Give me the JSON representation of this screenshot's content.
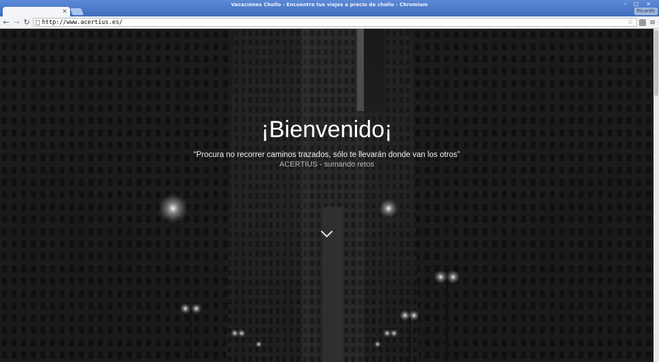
{
  "window": {
    "title": "Vacaciones Chollo - Encuentra tus viajes a precio de chollo - Chromium",
    "profile": "Ricardo",
    "controls": "– □ ×"
  },
  "tab": {
    "close": "×"
  },
  "toolbar": {
    "back": "←",
    "forward": "→",
    "reload": "↻",
    "url": "http://www.acertius.es/",
    "star": "☆",
    "menu": "≡"
  },
  "hero": {
    "title": "¡Bienvenido¡",
    "quote": "“Procura no recorrer caminos trazados, sólo te llevarán donde van los otros”",
    "subtitle": "ACERTIUS - sumando retos"
  }
}
